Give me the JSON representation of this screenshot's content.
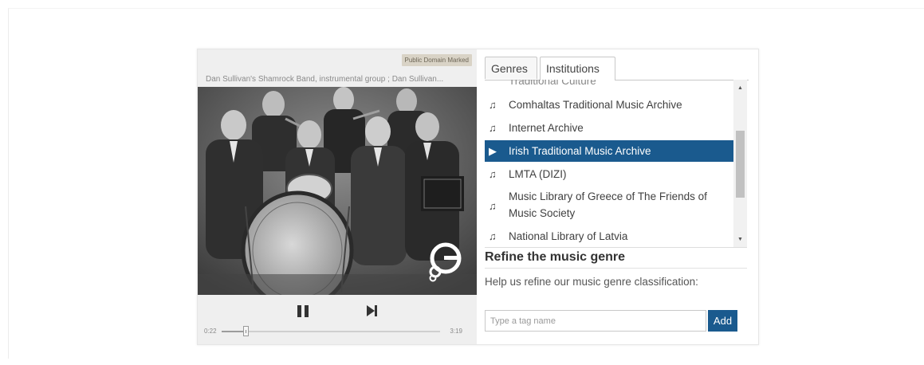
{
  "player": {
    "rights_badge": "Public Domain Marked",
    "track_caption": "Dan Sullivan's Shamrock Band, instrumental group ; Dan Sullivan...",
    "time_current": "0:22",
    "time_total": "3:19",
    "progress": 0.11,
    "pause_icon": "pause-icon",
    "next_icon": "skip-next-icon",
    "logo_icon": "europeana-logo-icon"
  },
  "panel": {
    "tabs": [
      {
        "label": "Genres",
        "active": false
      },
      {
        "label": "Institutions",
        "active": true
      }
    ],
    "list": [
      {
        "label": "Traditional Culture",
        "icon": "music-note-icon",
        "selected": false
      },
      {
        "label": "Comhaltas Traditional Music Archive",
        "icon": "music-note-icon",
        "selected": false
      },
      {
        "label": "Internet Archive",
        "icon": "music-note-icon",
        "selected": false
      },
      {
        "label": "Irish Traditional Music Archive",
        "icon": "play-icon",
        "selected": true
      },
      {
        "label": "LMTA (DIZI)",
        "icon": "music-note-icon",
        "selected": false
      },
      {
        "label": "Music Library of Greece of The Friends of Music Society",
        "icon": "music-note-icon",
        "selected": false
      },
      {
        "label": "National Library of Latvia",
        "icon": "music-note-icon",
        "selected": false
      }
    ],
    "refine": {
      "title": "Refine the music genre",
      "help": "Help us refine our music genre classification:",
      "input_placeholder": "Type a tag name",
      "input_value": "",
      "add_label": "Add"
    }
  },
  "colors": {
    "accent": "#1a5a8e",
    "badge_bg": "#d9d3c6",
    "player_bg": "#efefef"
  }
}
